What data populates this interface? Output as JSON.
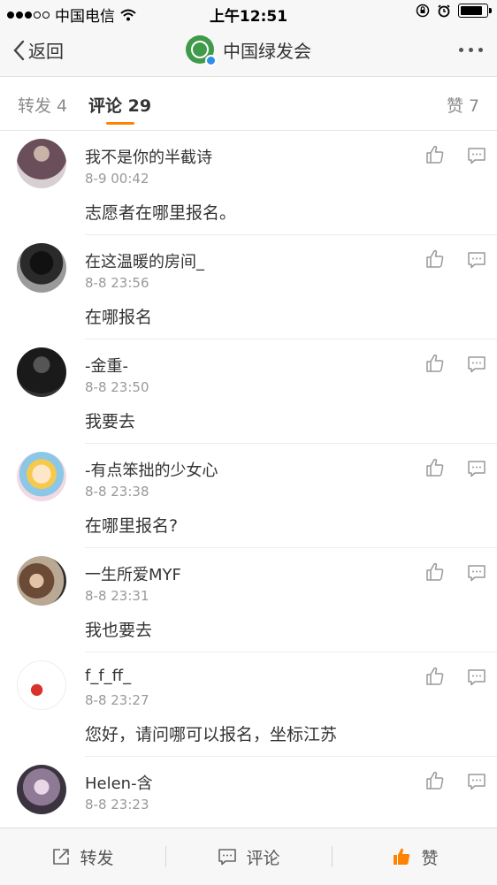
{
  "status_bar": {
    "carrier": "中国电信",
    "time": "上午12:51"
  },
  "nav": {
    "back_label": "返回",
    "title": "中国绿发会"
  },
  "tabs": [
    {
      "label": "转发 4"
    },
    {
      "label": "评论 29",
      "active": true
    },
    {
      "label": "赞 7"
    }
  ],
  "comments": [
    {
      "name": "我不是你的半截诗",
      "time": "8-9 00:42",
      "text": "志愿者在哪里报名。"
    },
    {
      "name": "在这温暖的房间_",
      "time": "8-8 23:56",
      "text": "在哪报名"
    },
    {
      "name": "-金重-",
      "time": "8-8 23:50",
      "text": "我要去"
    },
    {
      "name": "-有点笨拙的少女心",
      "time": "8-8 23:38",
      "text": "在哪里报名?"
    },
    {
      "name": "一生所爱MYF",
      "time": "8-8 23:31",
      "text": "我也要去"
    },
    {
      "name": "f_f_ff_",
      "time": "8-8 23:27",
      "text": "您好，请问哪可以报名，坐标江苏"
    },
    {
      "name": "Helen-含",
      "time": "8-8 23:23",
      "text": ""
    }
  ],
  "bottom_bar": {
    "repost_label": "转发",
    "comment_label": "评论",
    "like_label": "赞"
  },
  "colors": {
    "accent": "#ff8200",
    "verified": "#2e8fe6",
    "brand": "#3f9a4a"
  }
}
